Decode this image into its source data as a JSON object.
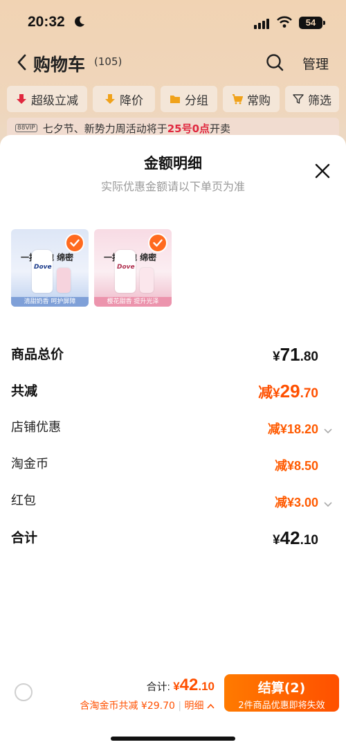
{
  "status_bar": {
    "time": "20:32",
    "battery": "54"
  },
  "nav": {
    "title": "购物车",
    "count": "(105)",
    "manage": "管理"
  },
  "filters": [
    {
      "label": "超级立减",
      "icon": "arrow-down-icon"
    },
    {
      "label": "降价",
      "icon": "price-drop-icon"
    },
    {
      "label": "分组",
      "icon": "folder-icon"
    },
    {
      "label": "常购",
      "icon": "cart-icon"
    },
    {
      "label": "筛选",
      "icon": "filter-icon"
    }
  ],
  "notice": {
    "badge": "88VIP",
    "text_before": "七夕节、新势力周活动将于",
    "highlight": "25号0点",
    "text_after": "开卖"
  },
  "sheet": {
    "title": "金额明细",
    "subtitle": "实际优惠金额请以下单页为准",
    "products": [
      {
        "caption": "一按出泡 绵密",
        "brand": "Dove",
        "footer": "清甜奶香 呵护屏障"
      },
      {
        "caption": "一按出泡 绵密",
        "brand": "Dove",
        "footer": "樱花甜香 提升光泽"
      }
    ],
    "rows": [
      {
        "label": "商品总价",
        "prefix": "",
        "currency": "¥",
        "integer": "71",
        "decimal": ".80"
      },
      {
        "label": "共减",
        "prefix": "减",
        "currency": "¥",
        "integer": "29",
        "decimal": ".70"
      },
      {
        "label": "店铺优惠",
        "prefix": "减",
        "currency": "¥",
        "integer": "18",
        "decimal": ".20"
      },
      {
        "label": "淘金币",
        "prefix": "减",
        "currency": "¥",
        "integer": "8",
        "decimal": ".50"
      },
      {
        "label": "红包",
        "prefix": "减",
        "currency": "¥",
        "integer": "3",
        "decimal": ".00"
      },
      {
        "label": "合计",
        "prefix": "",
        "currency": "¥",
        "integer": "42",
        "decimal": ".10"
      }
    ]
  },
  "bottom": {
    "total_label": "合计:",
    "total_currency": "¥",
    "total_integer": "42",
    "total_decimal": ".10",
    "discount_text": "含淘金币共减 ¥29.70",
    "separator": "|",
    "detail_link": "明细",
    "checkout_label": "结算(2)",
    "checkout_sub": "2件商品优惠即将失效"
  },
  "colors": {
    "accent": "#ff5000",
    "highlight": "#e0283f"
  }
}
